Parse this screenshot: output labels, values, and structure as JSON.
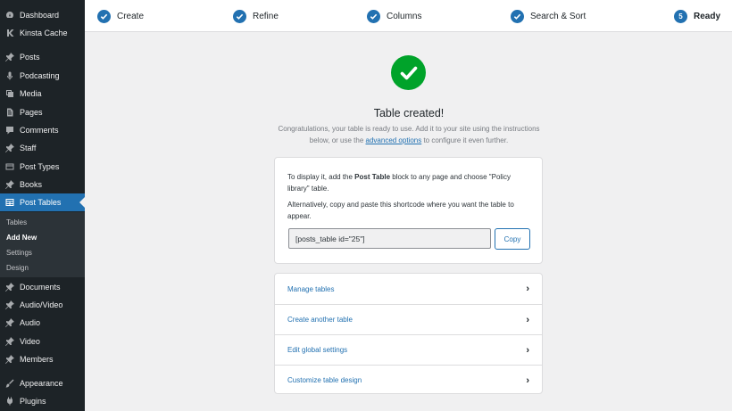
{
  "sidebar": {
    "items": [
      {
        "label": "Dashboard",
        "icon": "dashboard-icon"
      },
      {
        "label": "Kinsta Cache",
        "icon": "kinsta-icon"
      },
      {
        "label": "Posts",
        "icon": "pin-icon"
      },
      {
        "label": "Podcasting",
        "icon": "microphone-icon"
      },
      {
        "label": "Media",
        "icon": "media-icon"
      },
      {
        "label": "Pages",
        "icon": "page-icon"
      },
      {
        "label": "Comments",
        "icon": "comment-icon"
      },
      {
        "label": "Staff",
        "icon": "pin-icon"
      },
      {
        "label": "Post Types",
        "icon": "post-types-icon"
      },
      {
        "label": "Books",
        "icon": "pin-icon"
      },
      {
        "label": "Post Tables",
        "icon": "table-icon"
      },
      {
        "label": "Documents",
        "icon": "pin-icon"
      },
      {
        "label": "Audio/Video",
        "icon": "pin-icon"
      },
      {
        "label": "Audio",
        "icon": "pin-icon"
      },
      {
        "label": "Video",
        "icon": "pin-icon"
      },
      {
        "label": "Members",
        "icon": "pin-icon"
      },
      {
        "label": "Appearance",
        "icon": "brush-icon"
      },
      {
        "label": "Plugins",
        "icon": "plugin-icon"
      }
    ],
    "submenu": [
      "Tables",
      "Add New",
      "Settings",
      "Design"
    ]
  },
  "steps": [
    {
      "label": "Create",
      "done": true
    },
    {
      "label": "Refine",
      "done": true
    },
    {
      "label": "Columns",
      "done": true
    },
    {
      "label": "Search & Sort",
      "done": true
    },
    {
      "label": "Ready",
      "number": "5",
      "done": false
    }
  ],
  "main": {
    "title": "Table created!",
    "desc_before": "Congratulations, your table is ready to use. Add it to your site using the instructions below, or use the ",
    "desc_link": "advanced options",
    "desc_after": " to configure it even further.",
    "info_1_before": "To display it, add the ",
    "info_1_bold": "Post Table",
    "info_1_after": " block to any page and choose \"Policy library\" table.",
    "info_2": "Alternatively, copy and paste this shortcode where you want the table to appear.",
    "shortcode": "[posts_table id=\"25\"]",
    "copy_label": "Copy",
    "links": [
      "Manage tables",
      "Create another table",
      "Edit global settings",
      "Customize table design"
    ],
    "chevron": "›"
  },
  "colors": {
    "accent": "#2271b1",
    "success": "#00a32a",
    "sidebar": "#1d2327"
  }
}
